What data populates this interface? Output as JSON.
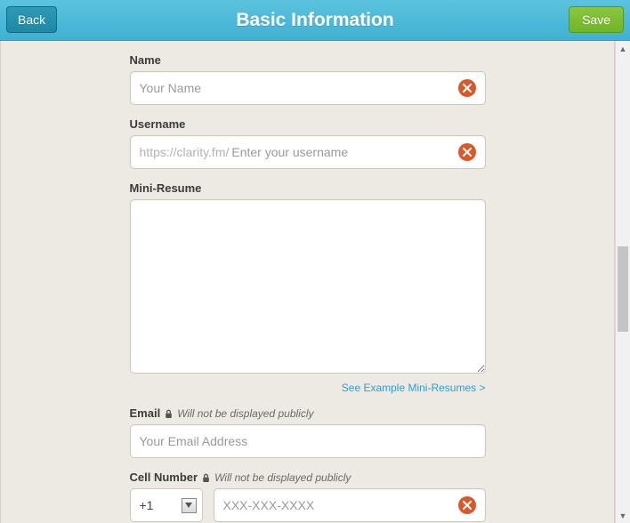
{
  "header": {
    "title": "Basic Information",
    "back_label": "Back",
    "save_label": "Save"
  },
  "form": {
    "name": {
      "label": "Name",
      "placeholder": "Your Name",
      "value": ""
    },
    "username": {
      "label": "Username",
      "prefix": "https://clarity.fm/",
      "placeholder": "Enter your username",
      "value": ""
    },
    "resume": {
      "label": "Mini-Resume",
      "value": "",
      "example_link": "See Example Mini-Resumes >"
    },
    "email": {
      "label": "Email",
      "hint": "Will not be displayed publicly",
      "placeholder": "Your Email Address",
      "value": ""
    },
    "cell": {
      "label": "Cell Number",
      "hint": "Will not be displayed publicly",
      "country_code": "+1",
      "placeholder": "XXX-XXX-XXXX",
      "value": ""
    }
  }
}
